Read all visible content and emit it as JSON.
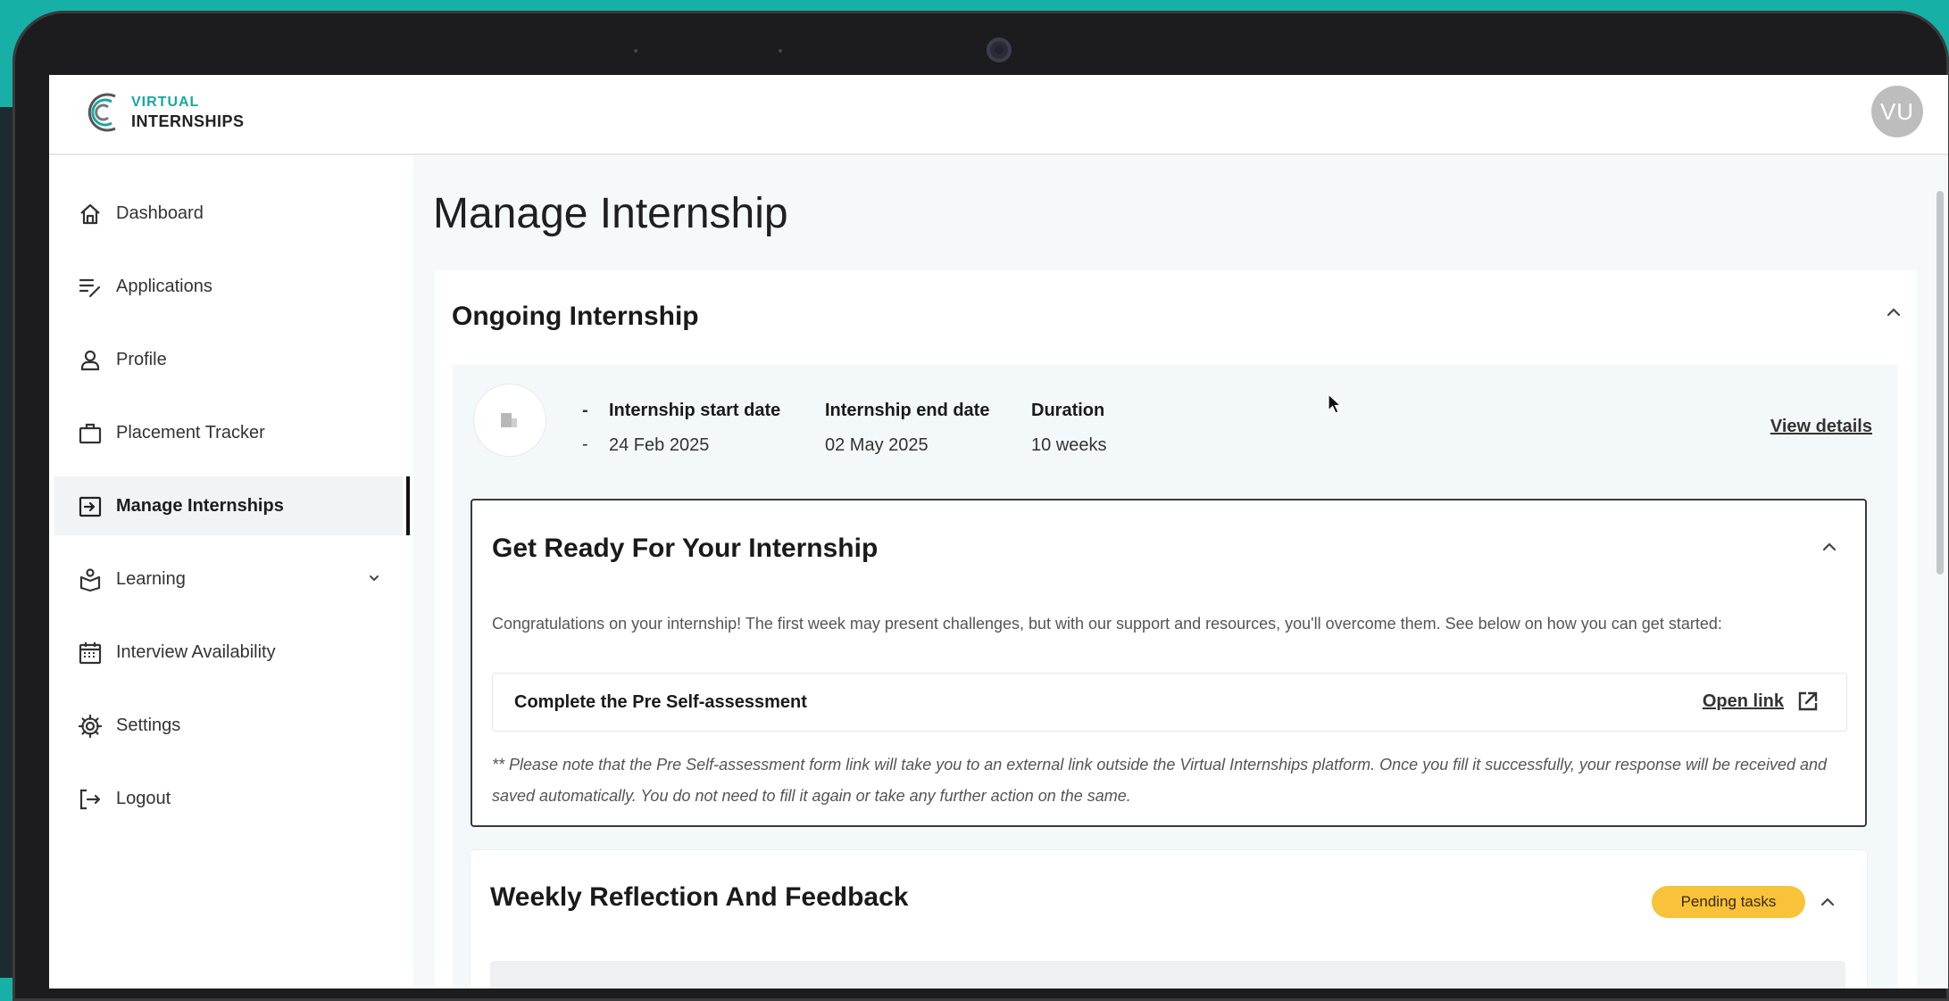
{
  "brand": {
    "line1": "VIRTUAL",
    "line2": "INTERNSHIPS",
    "accent": "#17a8a0"
  },
  "user": {
    "initials": "VU"
  },
  "sidebar": {
    "items": [
      {
        "label": "Dashboard",
        "icon": "home-icon",
        "active": false
      },
      {
        "label": "Applications",
        "icon": "list-edit-icon",
        "active": false
      },
      {
        "label": "Profile",
        "icon": "user-icon",
        "active": false
      },
      {
        "label": "Placement Tracker",
        "icon": "briefcase-icon",
        "active": false
      },
      {
        "label": "Manage Internships",
        "icon": "login-box-icon",
        "active": true
      },
      {
        "label": "Learning",
        "icon": "learning-icon",
        "active": false,
        "has_submenu": true
      },
      {
        "label": "Interview Availability",
        "icon": "calendar-icon",
        "active": false
      },
      {
        "label": "Settings",
        "icon": "gear-icon",
        "active": false
      },
      {
        "label": "Logout",
        "icon": "logout-icon",
        "active": false
      }
    ]
  },
  "main": {
    "title": "Manage Internship",
    "ongoing": {
      "title": "Ongoing Internship",
      "start_label": "Internship start date",
      "start_value": "24 Feb 2025",
      "end_label": "Internship end date",
      "end_value": "02 May 2025",
      "duration_label": "Duration",
      "duration_value": "10 weeks",
      "bullet1": "-",
      "bullet2": "-",
      "view_details": "View details"
    },
    "get_ready": {
      "title": "Get Ready For Your Internship",
      "description": "Congratulations on your internship! The first week may present challenges, but with our support and resources, you'll overcome them. See below on how you can get started:",
      "task_label": "Complete the Pre Self-assessment",
      "open_link": "Open link",
      "note": "** Please note that the Pre Self-assessment form link will take you to an external link outside the Virtual Internships platform. Once you fill it successfully, your response will be received and saved automatically. You do not need to fill it again or take any further action on the same."
    },
    "weekly": {
      "title": "Weekly Reflection And Feedback",
      "badge": "Pending tasks",
      "badge_color": "#f8c33a"
    }
  }
}
